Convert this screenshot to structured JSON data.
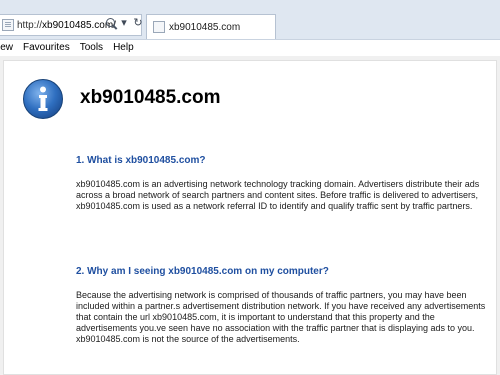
{
  "browser": {
    "address": {
      "prefix": "http://",
      "host": "xb9010485.com",
      "suffix": "/"
    },
    "tab_title": "xb9010485.com",
    "menu": [
      "iew",
      "Favourites",
      "Tools",
      "Help"
    ]
  },
  "page": {
    "title": "xb9010485.com",
    "sections": [
      {
        "heading": "1. What is xb9010485.com?",
        "body": "xb9010485.com is an advertising network technology tracking domain. Advertisers distribute their ads across a broad network of search partners and content sites. Before traffic is delivered to advertisers, xb9010485.com is used as a network referral ID to identify and qualify traffic sent by traffic partners."
      },
      {
        "heading": "2. Why am I seeing xb9010485.com on my computer?",
        "body": "Because the advertising network is comprised of thousands of traffic partners, you may have been included within a partner.s advertisement distribution network. If you have received any advertisements that contain the url xb9010485.com, it is important to understand that this property and the advertisements you.ve seen have no association with the traffic partner that is displaying ads to you. xb9010485.com is not the source of the advertisements."
      }
    ]
  },
  "colors": {
    "heading": "#1f4fa0",
    "info_icon": "#2f6fc0"
  }
}
